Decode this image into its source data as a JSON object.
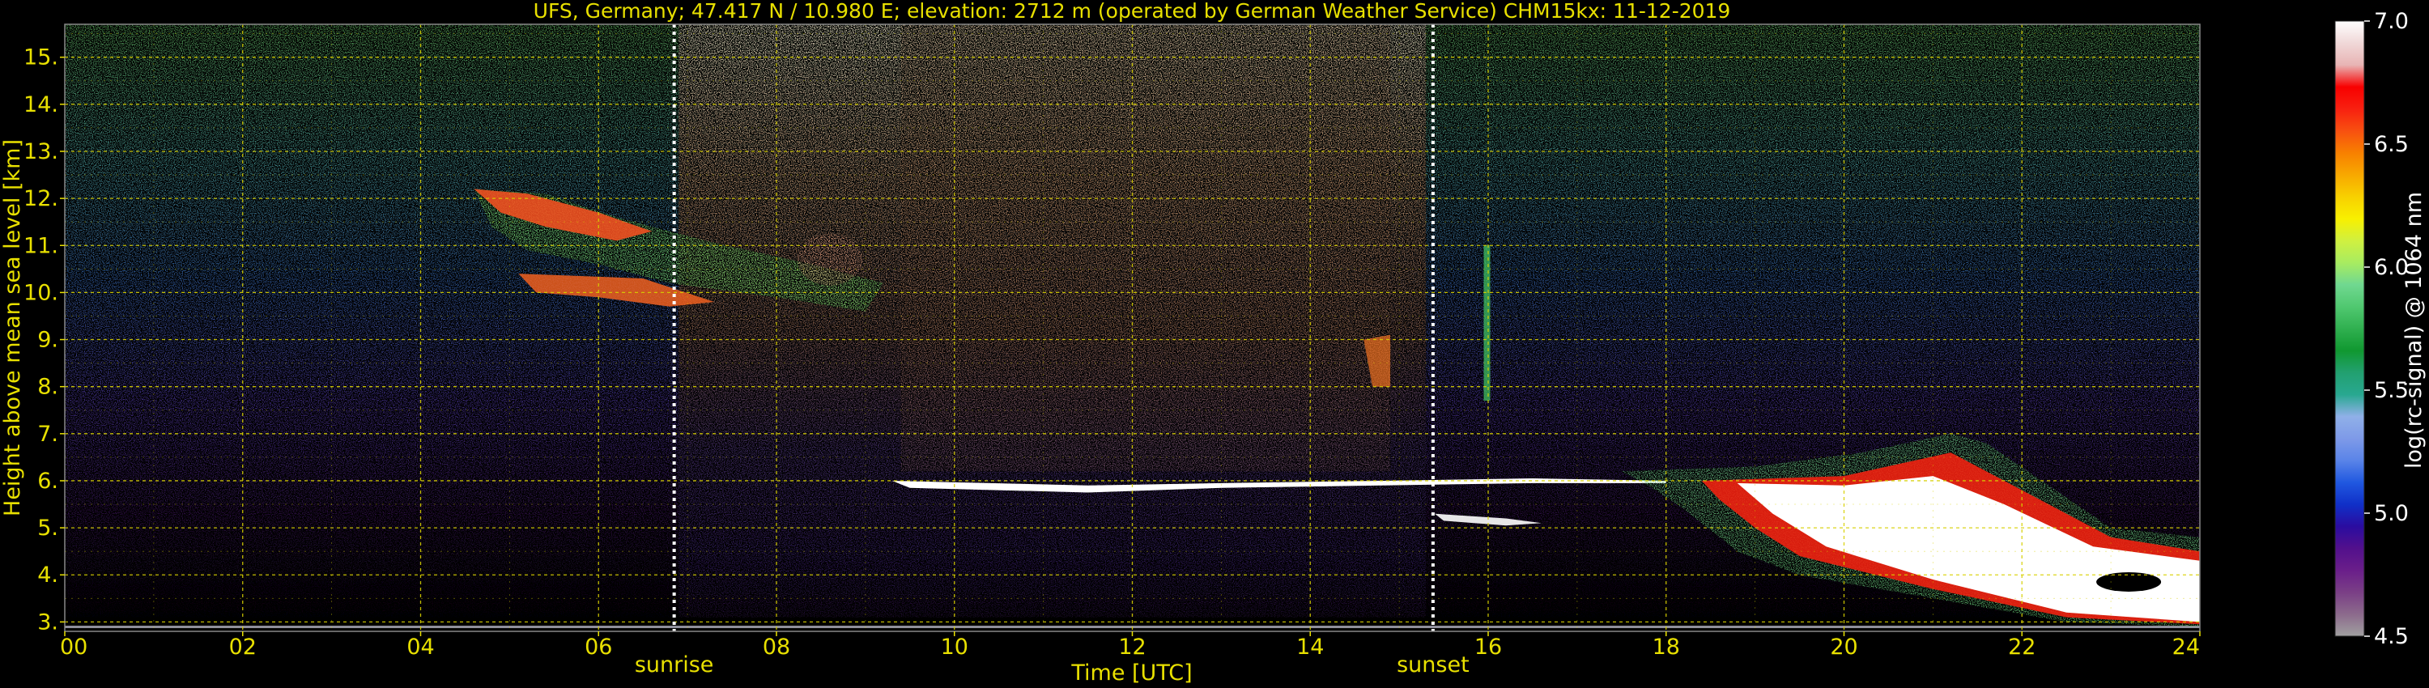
{
  "chart_data": {
    "type": "heatmap",
    "title": "UFS, Germany; 47.417 N / 10.980 E; elevation: 2712 m  (operated by German Weather Service)    CHM15kx: 11-12-2019",
    "xlabel": "Time [UTC]",
    "ylabel": "Height above mean sea level [km]",
    "colorbar_label": "log(rc-signal) @ 1064 nm",
    "xlim": [
      0,
      24
    ],
    "ylim": [
      2.8,
      15.7
    ],
    "x_ticks": [
      0,
      2,
      4,
      6,
      8,
      10,
      12,
      14,
      16,
      18,
      20,
      22,
      24
    ],
    "x_tick_labels": [
      "00",
      "02",
      "04",
      "06",
      "08",
      "10",
      "12",
      "14",
      "16",
      "18",
      "20",
      "22",
      "24"
    ],
    "y_ticks": [
      3,
      4,
      5,
      6,
      7,
      8,
      9,
      10,
      11,
      12,
      13,
      14,
      15
    ],
    "y_tick_labels": [
      "3.",
      "4.",
      "5.",
      "6.",
      "7.",
      "8.",
      "9.",
      "10.",
      "11.",
      "12.",
      "13.",
      "14.",
      "15."
    ],
    "color_range": [
      4.5,
      7.0
    ],
    "colorbar_ticks": [
      4.5,
      5.0,
      5.5,
      6.0,
      6.5,
      7.0
    ],
    "colorbar_tick_labels": [
      "4.5",
      "5.0",
      "5.5",
      "6.0",
      "6.5",
      "7.0"
    ],
    "colormap": [
      "#a0a0a0",
      "#8c6a8c",
      "#7a3f86",
      "#6a1e8a",
      "#52108c",
      "#2a0ca0",
      "#1030c8",
      "#2058e0",
      "#5a84e8",
      "#7e9ae8",
      "#90b0e8",
      "#28a890",
      "#22a070",
      "#109830",
      "#30b050",
      "#50c870",
      "#70d890",
      "#a8ec60",
      "#d0f040",
      "#f8f000",
      "#f8d000",
      "#f8a800",
      "#f88000",
      "#f85010",
      "#f82010",
      "#f80000",
      "#e8b4b4",
      "#f0d8d8",
      "#ffffff"
    ],
    "grid": true,
    "annotations": [
      {
        "text": "sunrise",
        "x": 6.85
      },
      {
        "text": "sunset",
        "x": 15.38
      }
    ]
  }
}
